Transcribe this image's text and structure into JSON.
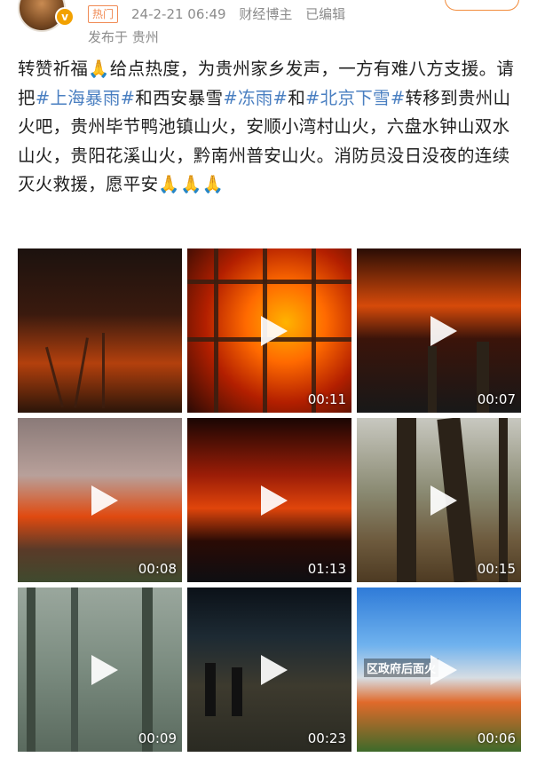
{
  "header": {
    "hot_tag": "热门",
    "date": "24-2-21 06:49",
    "source": "财经博主",
    "edited": "已编辑",
    "published": "发布于 贵州",
    "verified_badge": "v"
  },
  "post": {
    "segments": [
      {
        "t": "转赞祈福",
        "tag": false
      },
      {
        "t": "🙏",
        "tag": false
      },
      {
        "t": "给点热度，为贵州家乡发声，一方有难八方支援。请把",
        "tag": false
      },
      {
        "t": "#上海暴雨#",
        "tag": true
      },
      {
        "t": "和西安暴雪",
        "tag": false
      },
      {
        "t": "#冻雨#",
        "tag": true
      },
      {
        "t": "和",
        "tag": false
      },
      {
        "t": "#北京下雪#",
        "tag": true
      },
      {
        "t": "转移到贵州山火吧，贵州毕节鸭池镇山火，安顺小湾村山火，六盘水钟山双水山火，贵阳花溪山火，黔南州普安山火。消防员没日没夜的连续灭火救援，愿平安",
        "tag": false
      },
      {
        "t": "🙏🙏🙏",
        "tag": false
      }
    ]
  },
  "media": {
    "tiles": [
      {
        "name": "media-tile-1",
        "video": false,
        "duration": ""
      },
      {
        "name": "media-tile-2",
        "video": true,
        "duration": "00:11"
      },
      {
        "name": "media-tile-3",
        "video": true,
        "duration": "00:07"
      },
      {
        "name": "media-tile-4",
        "video": true,
        "duration": "00:08"
      },
      {
        "name": "media-tile-5",
        "video": true,
        "duration": "01:13"
      },
      {
        "name": "media-tile-6",
        "video": true,
        "duration": "00:15"
      },
      {
        "name": "media-tile-7",
        "video": true,
        "duration": "00:09"
      },
      {
        "name": "media-tile-8",
        "video": true,
        "duration": "00:23"
      },
      {
        "name": "media-tile-9",
        "video": true,
        "duration": "00:06",
        "caption": "区政府后面火"
      }
    ]
  }
}
